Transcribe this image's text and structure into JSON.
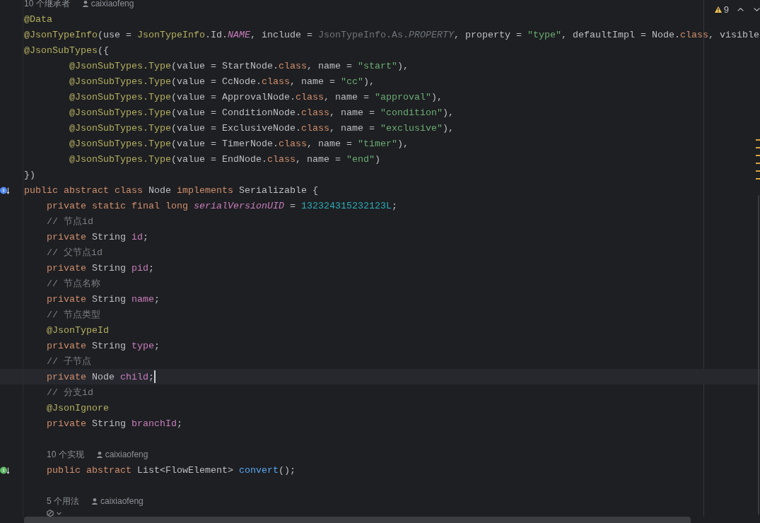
{
  "editor": {
    "lines": [
      {
        "kind": "hint",
        "label": "10 个继承者",
        "author": "caixiaofeng"
      },
      {
        "kind": "code",
        "current": false,
        "tokens": [
          {
            "kind": "annotation",
            "text": "@Data"
          }
        ]
      },
      {
        "kind": "code",
        "current": false,
        "tokens": [
          {
            "kind": "annotation",
            "text": "@JsonTypeInfo"
          },
          {
            "kind": "plain",
            "text": "(use = "
          },
          {
            "kind": "annotation",
            "text": "JsonTypeInfo"
          },
          {
            "kind": "plain",
            "text": ".Id."
          },
          {
            "kind": "constant",
            "text": "NAME"
          },
          {
            "kind": "plain",
            "text": ", include = "
          },
          {
            "kind": "unused",
            "text": "JsonTypeInfo.As."
          },
          {
            "kind": "unused_italic",
            "text": "PROPERTY"
          },
          {
            "kind": "plain",
            "text": ", property = "
          },
          {
            "kind": "string",
            "text": "\"type\""
          },
          {
            "kind": "plain",
            "text": ", defaultImpl = Node."
          },
          {
            "kind": "keyword",
            "text": "class"
          },
          {
            "kind": "plain",
            "text": ", visible"
          }
        ]
      },
      {
        "kind": "code",
        "current": false,
        "tokens": [
          {
            "kind": "annotation",
            "text": "@JsonSubTypes"
          },
          {
            "kind": "plain",
            "text": "({"
          }
        ]
      },
      {
        "kind": "code",
        "current": false,
        "tokens": [
          {
            "kind": "annotation",
            "text": "        @JsonSubTypes.Type"
          },
          {
            "kind": "plain",
            "text": "(value = StartNode."
          },
          {
            "kind": "keyword",
            "text": "class"
          },
          {
            "kind": "plain",
            "text": ", name = "
          },
          {
            "kind": "string",
            "text": "\"start\""
          },
          {
            "kind": "plain",
            "text": "),"
          }
        ]
      },
      {
        "kind": "code",
        "current": false,
        "tokens": [
          {
            "kind": "annotation",
            "text": "        @JsonSubTypes.Type"
          },
          {
            "kind": "plain",
            "text": "(value = CcNode."
          },
          {
            "kind": "keyword",
            "text": "class"
          },
          {
            "kind": "plain",
            "text": ", name = "
          },
          {
            "kind": "string",
            "text": "\"cc\""
          },
          {
            "kind": "plain",
            "text": "),"
          }
        ]
      },
      {
        "kind": "code",
        "current": false,
        "tokens": [
          {
            "kind": "annotation",
            "text": "        @JsonSubTypes.Type"
          },
          {
            "kind": "plain",
            "text": "(value = ApprovalNode."
          },
          {
            "kind": "keyword",
            "text": "class"
          },
          {
            "kind": "plain",
            "text": ", name = "
          },
          {
            "kind": "string",
            "text": "\"approval\""
          },
          {
            "kind": "plain",
            "text": "),"
          }
        ]
      },
      {
        "kind": "code",
        "current": false,
        "tokens": [
          {
            "kind": "annotation",
            "text": "        @JsonSubTypes.Type"
          },
          {
            "kind": "plain",
            "text": "(value = ConditionNode."
          },
          {
            "kind": "keyword",
            "text": "class"
          },
          {
            "kind": "plain",
            "text": ", name = "
          },
          {
            "kind": "string",
            "text": "\"condition\""
          },
          {
            "kind": "plain",
            "text": "),"
          }
        ]
      },
      {
        "kind": "code",
        "current": false,
        "tokens": [
          {
            "kind": "annotation",
            "text": "        @JsonSubTypes.Type"
          },
          {
            "kind": "plain",
            "text": "(value = ExclusiveNode."
          },
          {
            "kind": "keyword",
            "text": "class"
          },
          {
            "kind": "plain",
            "text": ", name = "
          },
          {
            "kind": "string",
            "text": "\"exclusive\""
          },
          {
            "kind": "plain",
            "text": "),"
          }
        ]
      },
      {
        "kind": "code",
        "current": false,
        "tokens": [
          {
            "kind": "annotation",
            "text": "        @JsonSubTypes.Type"
          },
          {
            "kind": "plain",
            "text": "(value = TimerNode."
          },
          {
            "kind": "keyword",
            "text": "class"
          },
          {
            "kind": "plain",
            "text": ", name = "
          },
          {
            "kind": "string",
            "text": "\"timer\""
          },
          {
            "kind": "plain",
            "text": "),"
          }
        ]
      },
      {
        "kind": "code",
        "current": false,
        "tokens": [
          {
            "kind": "annotation",
            "text": "        @JsonSubTypes.Type"
          },
          {
            "kind": "plain",
            "text": "(value = EndNode."
          },
          {
            "kind": "keyword",
            "text": "class"
          },
          {
            "kind": "plain",
            "text": ", name = "
          },
          {
            "kind": "string",
            "text": "\"end\""
          },
          {
            "kind": "plain",
            "text": ")"
          }
        ]
      },
      {
        "kind": "code",
        "current": false,
        "tokens": [
          {
            "kind": "plain",
            "text": "})"
          }
        ]
      },
      {
        "kind": "code",
        "current": false,
        "gutter_icon": {
          "kind": "subclassed"
        },
        "tokens": [
          {
            "kind": "keyword",
            "text": "public abstract class "
          },
          {
            "kind": "plain",
            "text": "Node "
          },
          {
            "kind": "keyword",
            "text": "implements "
          },
          {
            "kind": "plain",
            "text": "Serializable {"
          }
        ]
      },
      {
        "kind": "code",
        "current": false,
        "tokens": [
          {
            "kind": "keyword",
            "text": "    private static final long "
          },
          {
            "kind": "static_field",
            "text": "serialVersionUID"
          },
          {
            "kind": "plain",
            "text": " = "
          },
          {
            "kind": "number",
            "text": "132324315232123L"
          },
          {
            "kind": "plain",
            "text": ";"
          }
        ]
      },
      {
        "kind": "code",
        "current": false,
        "tokens": [
          {
            "kind": "comment",
            "text": "    // 节点id"
          }
        ]
      },
      {
        "kind": "code",
        "current": false,
        "tokens": [
          {
            "kind": "keyword",
            "text": "    private "
          },
          {
            "kind": "plain",
            "text": "String "
          },
          {
            "kind": "field",
            "text": "id"
          },
          {
            "kind": "plain",
            "text": ";"
          }
        ]
      },
      {
        "kind": "code",
        "current": false,
        "tokens": [
          {
            "kind": "comment",
            "text": "    // 父节点id"
          }
        ]
      },
      {
        "kind": "code",
        "current": false,
        "tokens": [
          {
            "kind": "keyword",
            "text": "    private "
          },
          {
            "kind": "plain",
            "text": "String "
          },
          {
            "kind": "field",
            "text": "pid"
          },
          {
            "kind": "plain",
            "text": ";"
          }
        ]
      },
      {
        "kind": "code",
        "current": false,
        "tokens": [
          {
            "kind": "comment",
            "text": "    // 节点名称"
          }
        ]
      },
      {
        "kind": "code",
        "current": false,
        "tokens": [
          {
            "kind": "keyword",
            "text": "    private "
          },
          {
            "kind": "plain",
            "text": "String "
          },
          {
            "kind": "field",
            "text": "name"
          },
          {
            "kind": "plain",
            "text": ";"
          }
        ]
      },
      {
        "kind": "code",
        "current": false,
        "tokens": [
          {
            "kind": "comment",
            "text": "    // 节点类型"
          }
        ]
      },
      {
        "kind": "code",
        "current": false,
        "tokens": [
          {
            "kind": "annotation",
            "text": "    @JsonTypeId"
          }
        ]
      },
      {
        "kind": "code",
        "current": false,
        "tokens": [
          {
            "kind": "keyword",
            "text": "    private "
          },
          {
            "kind": "plain",
            "text": "String "
          },
          {
            "kind": "field",
            "text": "type"
          },
          {
            "kind": "plain",
            "text": ";"
          }
        ]
      },
      {
        "kind": "code",
        "current": false,
        "tokens": [
          {
            "kind": "comment",
            "text": "    // 子节点"
          }
        ]
      },
      {
        "kind": "code",
        "current": true,
        "tokens": [
          {
            "kind": "keyword",
            "text": "    private "
          },
          {
            "kind": "plain",
            "text": "Node "
          },
          {
            "kind": "field",
            "text": "child"
          },
          {
            "kind": "plain",
            "text": ";"
          }
        ]
      },
      {
        "kind": "code",
        "current": false,
        "tokens": [
          {
            "kind": "comment",
            "text": "    // 分支id"
          }
        ]
      },
      {
        "kind": "code",
        "current": false,
        "tokens": [
          {
            "kind": "annotation",
            "text": "    @JsonIgnore"
          }
        ]
      },
      {
        "kind": "code",
        "current": false,
        "tokens": [
          {
            "kind": "keyword",
            "text": "    private "
          },
          {
            "kind": "plain",
            "text": "String "
          },
          {
            "kind": "field",
            "text": "branchId"
          },
          {
            "kind": "plain",
            "text": ";"
          }
        ]
      },
      {
        "kind": "blank"
      },
      {
        "kind": "hint",
        "label": "10 个实现",
        "author": "caixiaofeng"
      },
      {
        "kind": "code",
        "current": false,
        "gutter_icon": {
          "kind": "implemented"
        },
        "tokens": [
          {
            "kind": "keyword",
            "text": "    public abstract "
          },
          {
            "kind": "plain",
            "text": "List<FlowElement> "
          },
          {
            "kind": "method",
            "text": "convert"
          },
          {
            "kind": "plain",
            "text": "();"
          }
        ]
      },
      {
        "kind": "blank"
      },
      {
        "kind": "hint",
        "label": "5 个用法",
        "author": "caixiaofeng"
      },
      {
        "kind": "icon_row"
      }
    ]
  },
  "inspection_widget": {
    "count": "9"
  },
  "error_stripe": {
    "marks": [
      {
        "kind": "warning"
      },
      {
        "kind": "warning"
      },
      {
        "kind": "warning"
      },
      {
        "kind": "warning"
      },
      {
        "kind": "warning"
      },
      {
        "kind": "warning"
      }
    ]
  }
}
